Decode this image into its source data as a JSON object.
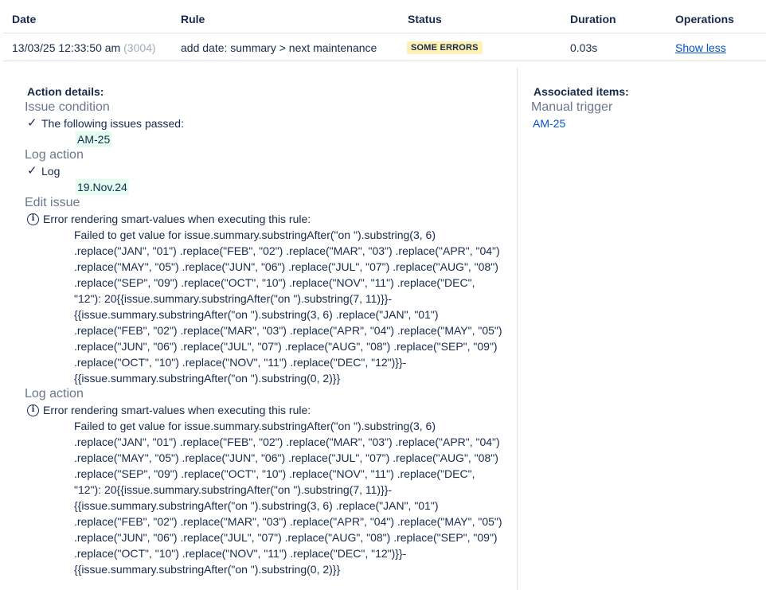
{
  "table": {
    "headers": {
      "date": "Date",
      "rule": "Rule",
      "status": "Status",
      "duration": "Duration",
      "operations": "Operations"
    },
    "row": {
      "date": "13/03/25 12:33:50 am",
      "id": "(3004)",
      "rule": "add date: summary > next maintenance",
      "status": "SOME ERRORS",
      "duration": "0.03s",
      "operation": "Show less"
    }
  },
  "details": {
    "heading": "Action details:",
    "components": [
      {
        "title": "Issue condition",
        "line": "The following issues passed:",
        "chip": "AM-25"
      },
      {
        "title": "Log action",
        "line": "Log",
        "chip": "19.Nov.24"
      },
      {
        "title": "Edit issue",
        "error_heading": "Error rendering smart-values when executing this rule:",
        "error_body": "Failed to get value for issue.summary.substringAfter(\"on \").substring(3, 6) .replace(\"JAN\", \"01\") .replace(\"FEB\", \"02\") .replace(\"MAR\", \"03\") .replace(\"APR\", \"04\") .replace(\"MAY\", \"05\") .replace(\"JUN\", \"06\") .replace(\"JUL\", \"07\") .replace(\"AUG\", \"08\") .replace(\"SEP\", \"09\") .replace(\"OCT\", \"10\") .replace(\"NOV\", \"11\") .replace(\"DEC\", \"12\"): 20{{issue.summary.substringAfter(\"on \").substring(7, 11)}}-{{issue.summary.substringAfter(\"on \").substring(3, 6) .replace(\"JAN\", \"01\") .replace(\"FEB\", \"02\") .replace(\"MAR\", \"03\") .replace(\"APR\", \"04\") .replace(\"MAY\", \"05\") .replace(\"JUN\", \"06\") .replace(\"JUL\", \"07\") .replace(\"AUG\", \"08\") .replace(\"SEP\", \"09\") .replace(\"OCT\", \"10\") .replace(\"NOV\", \"11\") .replace(\"DEC\", \"12\")}}-{{issue.summary.substringAfter(\"on \").substring(0, 2)}}"
      },
      {
        "title": "Log action",
        "error_heading": "Error rendering smart-values when executing this rule:",
        "error_body": "Failed to get value for issue.summary.substringAfter(\"on \").substring(3, 6) .replace(\"JAN\", \"01\") .replace(\"FEB\", \"02\") .replace(\"MAR\", \"03\") .replace(\"APR\", \"04\") .replace(\"MAY\", \"05\") .replace(\"JUN\", \"06\") .replace(\"JUL\", \"07\") .replace(\"AUG\", \"08\") .replace(\"SEP\", \"09\") .replace(\"OCT\", \"10\") .replace(\"NOV\", \"11\") .replace(\"DEC\", \"12\"): 20{{issue.summary.substringAfter(\"on \").substring(7, 11)}}-{{issue.summary.substringAfter(\"on \").substring(3, 6) .replace(\"JAN\", \"01\") .replace(\"FEB\", \"02\") .replace(\"MAR\", \"03\") .replace(\"APR\", \"04\") .replace(\"MAY\", \"05\") .replace(\"JUN\", \"06\") .replace(\"JUL\", \"07\") .replace(\"AUG\", \"08\") .replace(\"SEP\", \"09\") .replace(\"OCT\", \"10\") .replace(\"NOV\", \"11\") .replace(\"DEC\", \"12\")}}-{{issue.summary.substringAfter(\"on \").substring(0, 2)}}"
      }
    ]
  },
  "associated": {
    "heading": "Associated items:",
    "trigger": "Manual trigger",
    "item": "AM-25"
  },
  "icons": {
    "check": "check-icon",
    "info": "info-icon"
  },
  "colors": {
    "status_badge_bg": "#fff0b3",
    "chip_bg": "#e3fcef",
    "link": "#0052cc"
  }
}
